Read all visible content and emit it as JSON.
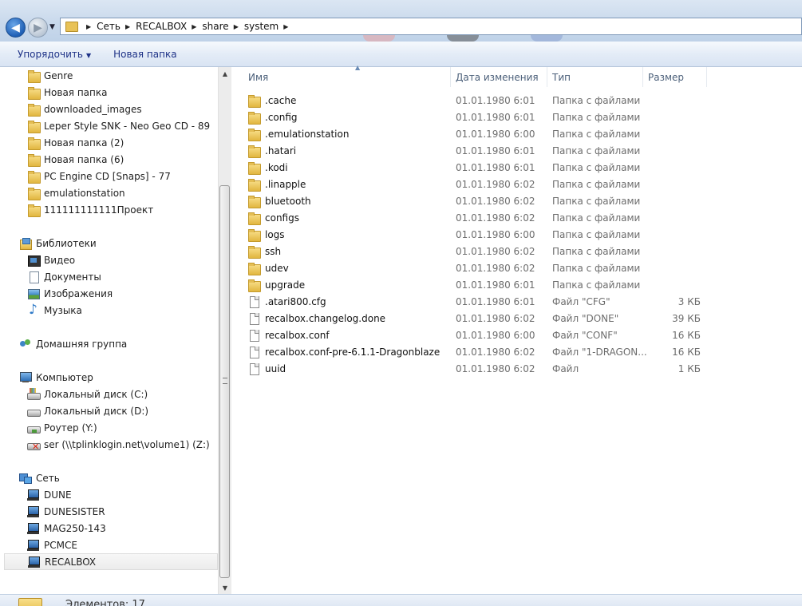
{
  "address_bar": {
    "crumbs": [
      "Сеть",
      "RECALBOX",
      "share",
      "system"
    ]
  },
  "toolbar": {
    "organize_label": "Упорядочить",
    "new_folder_label": "Новая папка"
  },
  "nav_pane": {
    "folders": [
      {
        "label": "Genre"
      },
      {
        "label": "Новая папка"
      },
      {
        "label": "downloaded_images"
      },
      {
        "label": "Leper Style SNK - Neo Geo CD - 89"
      },
      {
        "label": "Новая папка (2)"
      },
      {
        "label": "Новая папка (6)"
      },
      {
        "label": "PC Engine CD [Snaps] - 77"
      },
      {
        "label": "emulationstation"
      },
      {
        "label": "111111111111Проект"
      }
    ],
    "libraries": {
      "label": "Библиотеки",
      "items": [
        {
          "label": "Видео",
          "icon": "video-icon"
        },
        {
          "label": "Документы",
          "icon": "documents-icon"
        },
        {
          "label": "Изображения",
          "icon": "pictures-icon"
        },
        {
          "label": "Музыка",
          "icon": "music-icon"
        }
      ]
    },
    "homegroup": {
      "label": "Домашняя группа"
    },
    "computer": {
      "label": "Компьютер",
      "items": [
        {
          "label": "Локальный диск (C:)",
          "icon": "windows-drive-icon"
        },
        {
          "label": "Локальный диск (D:)",
          "icon": "drive-icon"
        },
        {
          "label": "Роутер (Y:)",
          "icon": "network-drive-icon"
        },
        {
          "label": "ser (\\\\tplinklogin.net\\volume1) (Z:)",
          "icon": "disconnected-network-drive-icon"
        }
      ]
    },
    "network": {
      "label": "Сеть",
      "items": [
        {
          "label": "DUNE"
        },
        {
          "label": "DUNESISTER"
        },
        {
          "label": "MAG250-143"
        },
        {
          "label": "PCMCE"
        },
        {
          "label": "RECALBOX",
          "selected": true
        }
      ]
    }
  },
  "file_list": {
    "columns": {
      "name": "Имя",
      "date": "Дата изменения",
      "type": "Тип",
      "size": "Размер"
    },
    "rows": [
      {
        "name": ".cache",
        "date": "01.01.1980 6:01",
        "type": "Папка с файлами",
        "size": "",
        "kind": "folder"
      },
      {
        "name": ".config",
        "date": "01.01.1980 6:01",
        "type": "Папка с файлами",
        "size": "",
        "kind": "folder"
      },
      {
        "name": ".emulationstation",
        "date": "01.01.1980 6:00",
        "type": "Папка с файлами",
        "size": "",
        "kind": "folder"
      },
      {
        "name": ".hatari",
        "date": "01.01.1980 6:01",
        "type": "Папка с файлами",
        "size": "",
        "kind": "folder"
      },
      {
        "name": ".kodi",
        "date": "01.01.1980 6:01",
        "type": "Папка с файлами",
        "size": "",
        "kind": "folder"
      },
      {
        "name": ".linapple",
        "date": "01.01.1980 6:02",
        "type": "Папка с файлами",
        "size": "",
        "kind": "folder"
      },
      {
        "name": "bluetooth",
        "date": "01.01.1980 6:02",
        "type": "Папка с файлами",
        "size": "",
        "kind": "folder"
      },
      {
        "name": "configs",
        "date": "01.01.1980 6:02",
        "type": "Папка с файлами",
        "size": "",
        "kind": "folder"
      },
      {
        "name": "logs",
        "date": "01.01.1980 6:00",
        "type": "Папка с файлами",
        "size": "",
        "kind": "folder"
      },
      {
        "name": "ssh",
        "date": "01.01.1980 6:02",
        "type": "Папка с файлами",
        "size": "",
        "kind": "folder"
      },
      {
        "name": "udev",
        "date": "01.01.1980 6:02",
        "type": "Папка с файлами",
        "size": "",
        "kind": "folder"
      },
      {
        "name": "upgrade",
        "date": "01.01.1980 6:01",
        "type": "Папка с файлами",
        "size": "",
        "kind": "folder"
      },
      {
        "name": ".atari800.cfg",
        "date": "01.01.1980 6:01",
        "type": "Файл \"CFG\"",
        "size": "3 КБ",
        "kind": "file"
      },
      {
        "name": "recalbox.changelog.done",
        "date": "01.01.1980 6:02",
        "type": "Файл \"DONE\"",
        "size": "39 КБ",
        "kind": "file"
      },
      {
        "name": "recalbox.conf",
        "date": "01.01.1980 6:00",
        "type": "Файл \"CONF\"",
        "size": "16 КБ",
        "kind": "file"
      },
      {
        "name": "recalbox.conf-pre-6.1.1-Dragonblaze",
        "date": "01.01.1980 6:02",
        "type": "Файл \"1-DRAGON...",
        "size": "16 КБ",
        "kind": "file"
      },
      {
        "name": "uuid",
        "date": "01.01.1980 6:02",
        "type": "Файл",
        "size": "1 КБ",
        "kind": "file"
      }
    ]
  },
  "status_bar": {
    "count_text": "Элементов: 17"
  }
}
